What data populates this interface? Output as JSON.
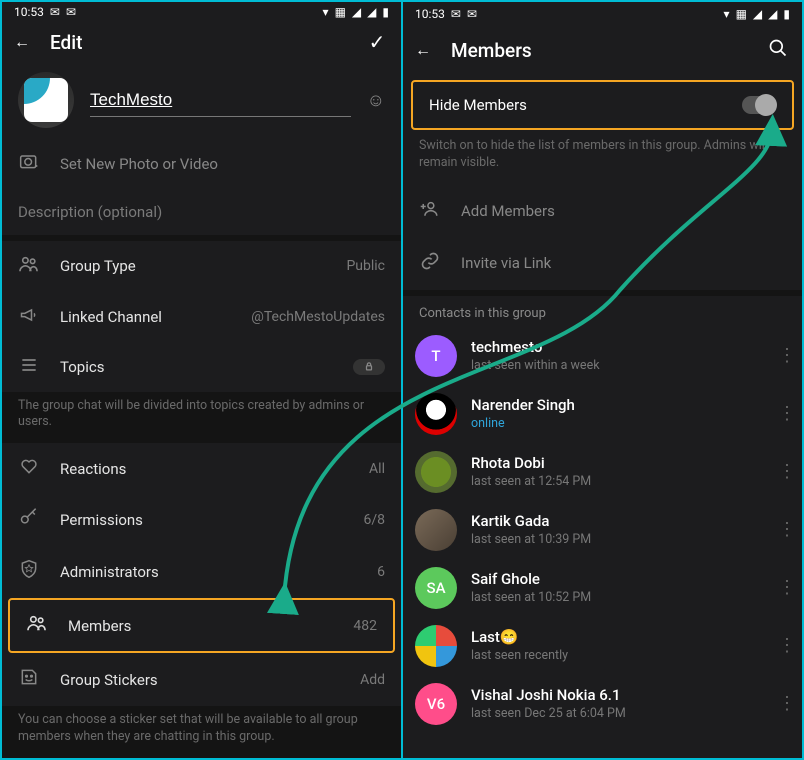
{
  "status": {
    "time": "10:53",
    "icon1": "✉",
    "icon2": "✉",
    "wifi": "▾",
    "calc": "▦",
    "sig1": "◢",
    "sig2": "◢",
    "batt": "▮"
  },
  "left": {
    "header": {
      "back": "←",
      "title": "Edit",
      "confirm": "✓"
    },
    "group_name": "TechMesto",
    "set_photo": "Set New Photo or Video",
    "description_placeholder": "Description (optional)",
    "rows": {
      "group_type": {
        "label": "Group Type",
        "value": "Public"
      },
      "linked_channel": {
        "label": "Linked Channel",
        "value": "@TechMestoUpdates"
      },
      "topics": {
        "label": "Topics"
      },
      "topics_hint": "The group chat will be divided into topics created by admins or users.",
      "reactions": {
        "label": "Reactions",
        "value": "All"
      },
      "permissions": {
        "label": "Permissions",
        "value": "6/8"
      },
      "administrators": {
        "label": "Administrators",
        "value": "6"
      },
      "members": {
        "label": "Members",
        "value": "482"
      },
      "stickers": {
        "label": "Group Stickers",
        "value": "Add"
      },
      "stickers_hint": "You can choose a sticker set that will be available to all group members when they are chatting in this group."
    }
  },
  "right": {
    "header": {
      "back": "←",
      "title": "Members",
      "search": "🔍"
    },
    "hide_members_label": "Hide Members",
    "hide_members_hint": "Switch on to hide the list of members in this group. Admins will remain visible.",
    "add_members": "Add Members",
    "invite_link": "Invite via Link",
    "contacts_header": "Contacts in this group",
    "members": [
      {
        "name": "techmesto",
        "status": "last seen within a week",
        "initial": "T",
        "color": "#9c5cff"
      },
      {
        "name": "Narender Singh",
        "status": "online",
        "online": true,
        "avatar": "custom1"
      },
      {
        "name": "Rhota Dobi",
        "status": "last seen at 12:54 PM",
        "avatar": "turtle"
      },
      {
        "name": "Kartik Gada",
        "status": "last seen at 10:39 PM",
        "avatar": "cat"
      },
      {
        "name": "Saif Ghole",
        "status": "last seen at 10:52 PM",
        "initial": "SA",
        "color": "#5cc95c"
      },
      {
        "name": "Last😁",
        "status": "last seen recently",
        "avatar": "collage"
      },
      {
        "name": "Vishal Joshi Nokia 6.1",
        "status": "last seen Dec 25 at 6:04 PM",
        "initial": "V6",
        "color": "#ff4d8a"
      }
    ]
  }
}
